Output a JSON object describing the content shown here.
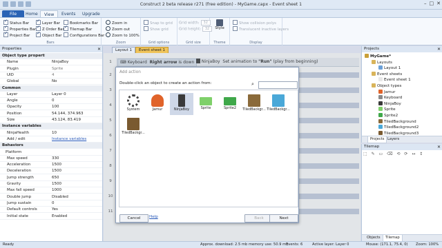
{
  "title_bar": {
    "title": "Construct 2 beta release r271  (free edition) - MyGame.capx - Event sheet 1"
  },
  "ribbon_tabs": [
    "File",
    "Home",
    "View",
    "Events",
    "Upgrade"
  ],
  "ribbon": {
    "bars": {
      "label": "Bars",
      "items": [
        {
          "label": "Status Bar",
          "checked": true
        },
        {
          "label": "Properties Bar",
          "checked": true
        },
        {
          "label": "Project Bar",
          "checked": true
        },
        {
          "label": "Layer Bar",
          "checked": true
        },
        {
          "label": "Z Order Bar",
          "checked": true
        },
        {
          "label": "Object Bar",
          "checked": true
        },
        {
          "label": "Bookmarks Bar",
          "checked": false
        },
        {
          "label": "Tilemap Bar",
          "checked": true
        },
        {
          "label": "Configurations Bar",
          "checked": false
        }
      ]
    },
    "zoom": {
      "label": "Zoom",
      "items": [
        "Zoom in",
        "Zoom out",
        "Zoom to 100%"
      ]
    },
    "grid": {
      "label": "Grid options",
      "items": [
        "Snap to grid",
        "Show grid"
      ]
    },
    "grid_size": {
      "label": "Grid size",
      "width_label": "Grid width:",
      "width_value": "32",
      "height_label": "Grid height:",
      "height_value": "32"
    },
    "theme": {
      "label": "Theme",
      "style_label": "Style"
    },
    "display": {
      "label": "Display",
      "items": [
        "Show collision polys",
        "Translucent inactive layers"
      ]
    }
  },
  "properties": {
    "header": "Properties",
    "rows": [
      {
        "k": "Object type properties",
        "v": "",
        "type": "sec"
      },
      {
        "k": "Name",
        "v": "NinjaBoy"
      },
      {
        "k": "Plugin",
        "v": "Sprite",
        "gry": true
      },
      {
        "k": "UID",
        "v": "4",
        "gry": true
      },
      {
        "k": "Global",
        "v": "No"
      },
      {
        "k": "Common",
        "v": "",
        "type": "sec"
      },
      {
        "k": "Layer",
        "v": "Layer 0"
      },
      {
        "k": "Angle",
        "v": "0"
      },
      {
        "k": "Opacity",
        "v": "100"
      },
      {
        "k": "Position",
        "v": "54.144, 374.963"
      },
      {
        "k": "Size",
        "v": "43.124, 83.419"
      },
      {
        "k": "Instance variables",
        "v": "",
        "type": "sec"
      },
      {
        "k": "NinjaHealth",
        "v": "10"
      },
      {
        "k": "Add / edit",
        "v": "Instance variables",
        "link": true
      },
      {
        "k": "Behaviors",
        "v": "",
        "type": "sec"
      },
      {
        "k": "Platform",
        "v": "",
        "type": "sub"
      },
      {
        "k": "Max speed",
        "v": "330"
      },
      {
        "k": "Acceleration",
        "v": "1500"
      },
      {
        "k": "Deceleration",
        "v": "1500"
      },
      {
        "k": "Jump strength",
        "v": "650"
      },
      {
        "k": "Gravity",
        "v": "1500"
      },
      {
        "k": "Max fall speed",
        "v": "1000"
      },
      {
        "k": "Double jump",
        "v": "Disabled"
      },
      {
        "k": "Jump sustain",
        "v": "0"
      },
      {
        "k": "Default controls",
        "v": "Yes"
      },
      {
        "k": "Initial state",
        "v": "Enabled"
      }
    ]
  },
  "doc_tabs": [
    "Layout 1",
    "Event sheet 1"
  ],
  "event": {
    "number": "1",
    "cond_object": "Keyboard",
    "cond_text_bold": "Right arrow",
    "cond_text_rest": " is down",
    "act_object": "NinjaBoy",
    "act_text_pre": "Set animation to ",
    "act_text_bold": "\"Run\"",
    "act_text_post": " (play from beginning)"
  },
  "event_numbers": [
    "2",
    "3",
    "4",
    "5",
    "6",
    "7",
    "8",
    "9",
    "10",
    "11"
  ],
  "dialog": {
    "title": "Add action",
    "instruction": "Double-click an object to create an action from:",
    "objects": [
      {
        "name": "System",
        "color": "#555555"
      },
      {
        "name": "Jamur",
        "color": "#e0632a"
      },
      {
        "name": "NinjaBoy",
        "color": "#3a3a3a"
      },
      {
        "name": "Sprite",
        "color": "#7fd06a"
      },
      {
        "name": "Sprite2",
        "color": "#3fa84a"
      },
      {
        "name": "TiledBackgr...",
        "color": "#8a6a3a"
      },
      {
        "name": "TiledBackgr...",
        "color": "#4aa8d8"
      },
      {
        "name": "TiledBackgr...",
        "color": "#7a5a30"
      }
    ],
    "buttons": {
      "cancel": "Cancel",
      "help": "Help",
      "back": "Back",
      "next": "Next"
    }
  },
  "projects": {
    "header": "Projects",
    "tree": [
      {
        "label": "MyGame*",
        "depth": 0,
        "bold": true,
        "color": "#c9a03a"
      },
      {
        "label": "Layouts",
        "depth": 1,
        "color": "#d9b45a"
      },
      {
        "label": "Layout 1",
        "depth": 2,
        "color": "#6aa0d8"
      },
      {
        "label": "Event sheets",
        "depth": 1,
        "color": "#d9b45a"
      },
      {
        "label": "Event sheet 1",
        "depth": 2,
        "color": "#e8e8e8"
      },
      {
        "label": "Object types",
        "depth": 1,
        "color": "#d9b45a"
      },
      {
        "label": "Jamur",
        "depth": 2,
        "color": "#e0632a"
      },
      {
        "label": "Keyboard",
        "depth": 2,
        "color": "#8a8a8a"
      },
      {
        "label": "NinjaBoy",
        "depth": 2,
        "color": "#3a3a3a"
      },
      {
        "label": "Sprite",
        "depth": 2,
        "color": "#7fd06a"
      },
      {
        "label": "Sprite2",
        "depth": 2,
        "color": "#3fa84a"
      },
      {
        "label": "TiledBackground",
        "depth": 2,
        "color": "#8a6a3a"
      },
      {
        "label": "TiledBackground2",
        "depth": 2,
        "color": "#4aa8d8"
      },
      {
        "label": "TiledBackground3",
        "depth": 2,
        "color": "#7a5a30"
      }
    ],
    "tabs": [
      "Projects",
      "Layers"
    ]
  },
  "tilemap": {
    "header": "Tilemap",
    "tools": "⬚ ✎ ▭ ⌫ ⟲ ⟳ ↔ ↕",
    "tabs": [
      "Objects",
      "Tilemap"
    ]
  },
  "status": {
    "left": "Ready",
    "download": "Approx. download: 2.5 mb",
    "memory": "memory use: 50.9 mb",
    "events": "Events: 6",
    "layer": "Active layer: Layer 0",
    "mouse": "Mouse: (171.1, 75.4, 0)",
    "zoom": "Zoom: 100%"
  },
  "colors": {
    "accent": "#2a63b5",
    "sheet_tab": "#f0c45a"
  }
}
